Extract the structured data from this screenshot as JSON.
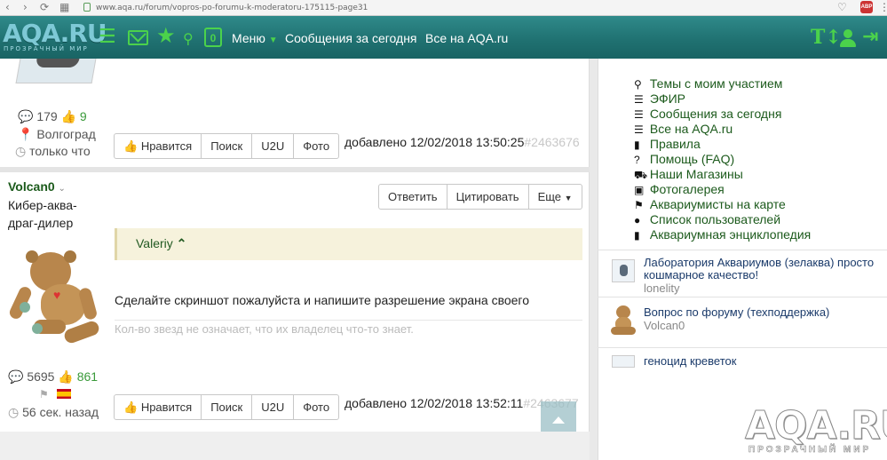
{
  "browser": {
    "url": "www.aqa.ru/forum/vopros-po-forumu-k-moderatoru-175115-page31",
    "back_icon": "‹",
    "forward_icon": "›",
    "reload_icon": "⟳",
    "apps_icon": "▦",
    "star_icon": "♡",
    "ext_label": "ABP",
    "menu_icon": "⋮"
  },
  "header": {
    "logo": "AQA.RU",
    "logo_sub": "ПРОЗРАЧНЫЙ МИР",
    "notif_count": "0",
    "menu_label": "Меню",
    "links": [
      "Сообщения за сегодня",
      "Все на AQA.ru"
    ],
    "accent": "#4bd24b"
  },
  "post1": {
    "replies": "179",
    "likes": "9",
    "city": "Волгоград",
    "status": "только что",
    "buttons": [
      "Нравится",
      "Поиск",
      "U2U",
      "Фото"
    ],
    "added": "добавлено 12/02/2018 13:50:25",
    "post_id": "#2463676"
  },
  "post2": {
    "author": "Volcan0",
    "rank": [
      "Кибер-аква-",
      "драг-дилер"
    ],
    "actions": [
      "Ответить",
      "Цитировать",
      "Еще"
    ],
    "quote_author": "Valeriy",
    "message": "Сделайте скриншот пожалуйста и напишите разрешение экрана своего",
    "signature": "Кол-во звезд не означает, что их владелец что-то знает.",
    "replies": "5695",
    "likes": "861",
    "status": "56 сек. назад",
    "buttons": [
      "Нравится",
      "Поиск",
      "U2U",
      "Фото"
    ],
    "added": "добавлено 12/02/2018 13:52:11",
    "post_id": "#2463677"
  },
  "sidebar": {
    "menu": [
      {
        "icon": "⚲",
        "label": "Темы с моим участием"
      },
      {
        "icon": "☰",
        "label": "ЭФИР"
      },
      {
        "icon": "☰",
        "label": "Сообщения за сегодня"
      },
      {
        "icon": "☰",
        "label": "Все на AQA.ru"
      },
      {
        "icon": "▮",
        "label": "Правила"
      },
      {
        "icon": "?",
        "label": "Помощь (FAQ)"
      },
      {
        "icon": "⛟",
        "label": "Наши Магазины"
      },
      {
        "icon": "▣",
        "label": "Фотогалерея"
      },
      {
        "icon": "⚑",
        "label": "Аквариумисты на карте"
      },
      {
        "icon": "●",
        "label": "Список пользователей"
      },
      {
        "icon": "▮",
        "label": "Аквариумная энциклопедия"
      }
    ],
    "topics": [
      {
        "title": "Лаборатория Аквариумов (зелаква) просто кошмарное качество!",
        "user": "lonelity"
      },
      {
        "title": "Вопрос по форуму (техподдержка)",
        "user": "Volcan0"
      },
      {
        "title": "геноцид креветок",
        "user": ""
      }
    ]
  },
  "watermark": {
    "logo": "AQA.RU",
    "sub": "ПРОЗРАЧНЫЙ МИР"
  }
}
